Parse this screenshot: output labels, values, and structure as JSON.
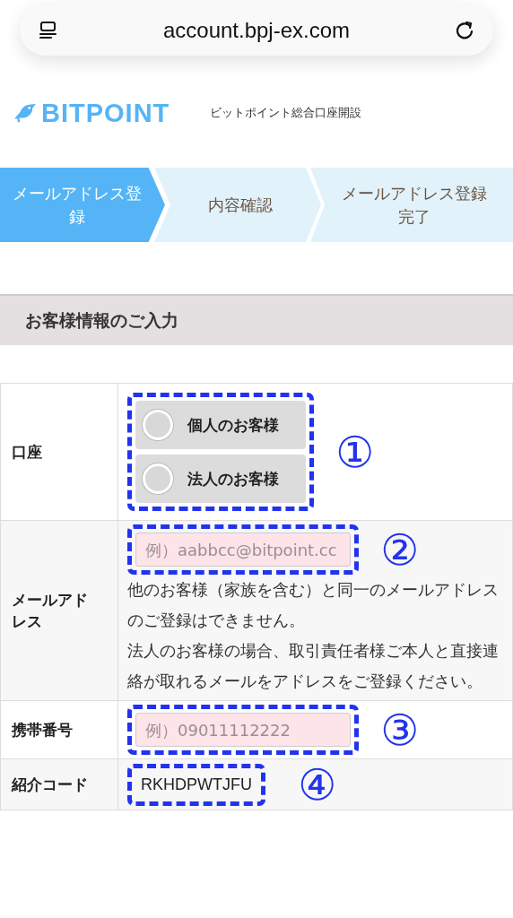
{
  "address_bar": {
    "url": "account.bpj-ex.com"
  },
  "header": {
    "logo": "BITPOINT",
    "subtitle": "ビットポイント総合口座開設"
  },
  "steps": [
    {
      "label": "メールアドレス登録",
      "selected": true
    },
    {
      "label": "内容確認",
      "selected": false
    },
    {
      "label": "メールアドレス登録完了",
      "selected": false
    }
  ],
  "section": {
    "title": "お客様情報のご入力"
  },
  "form": {
    "rows": [
      {
        "kind": "radio",
        "label": "口座",
        "marker": "①",
        "options": [
          {
            "label": "個人のお客様",
            "selected": false
          },
          {
            "label": "法人のお客様",
            "selected": false
          }
        ]
      },
      {
        "kind": "input",
        "label": "メールアドレス",
        "marker": "②",
        "placeholder": "例）aabbcc@bitpoint.cc",
        "notes": [
          "他のお客様（家族を含む）と同一のメールアドレスのご登録はできません。",
          "法人のお客様の場合、取引責任者様ご本人と直接連絡が取れるメールをアドレスをご登録ください。"
        ]
      },
      {
        "kind": "input",
        "label": "携帯番号",
        "marker": "③",
        "placeholder": "例）09011112222"
      },
      {
        "kind": "text",
        "label": "紹介コード",
        "marker": "④",
        "value": "RKHDPWTJFU"
      }
    ]
  }
}
